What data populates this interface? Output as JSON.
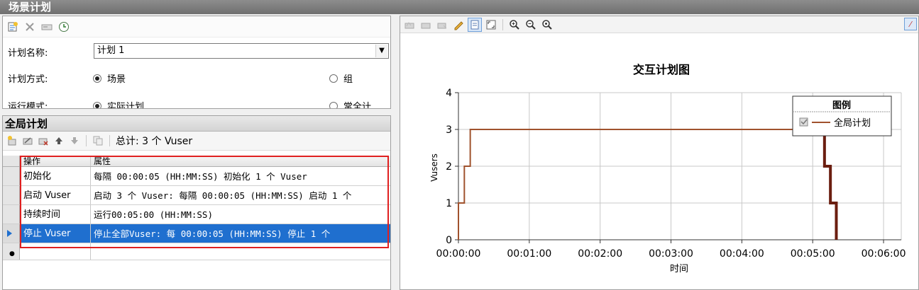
{
  "window": {
    "title": "场景计划"
  },
  "left_toolbar": {
    "icons": [
      "new-schedule-icon",
      "delete-icon",
      "rename-icon",
      "clock-icon"
    ]
  },
  "schedule": {
    "name_label": "计划名称:",
    "name_value": "计划 1",
    "mode_label": "计划方式:",
    "mode_option_scenario": "场景",
    "mode_option_group": "组",
    "run_label": "运行模式:",
    "run_option_real": "实际计划",
    "run_option_basic": "常全计"
  },
  "global": {
    "title": "全局计划",
    "total": "总计: 3 个 Vuser",
    "columns": [
      "操作",
      "属性"
    ],
    "rows": [
      {
        "action": "初始化",
        "property": "每隔 00:00:05 (HH:MM:SS) 初始化 1 个 Vuser"
      },
      {
        "action": "启动 Vuser",
        "property": "启动 3 个 Vuser: 每隔 00:00:05 (HH:MM:SS) 启动 1 个"
      },
      {
        "action": "持续时间",
        "property": "运行00:05:00 (HH:MM:SS)"
      },
      {
        "action": "停止 Vuser",
        "property": "停止全部Vuser: 每 00:00:05 (HH:MM:SS) 停止 1 个"
      }
    ]
  },
  "chart_data": {
    "type": "line",
    "title": "交互计划图",
    "xlabel": "时间",
    "ylabel": "Vusers",
    "xlim": [
      0,
      375
    ],
    "ylim": [
      0,
      4
    ],
    "x_ticks": [
      "00:00:00",
      "00:01:00",
      "00:02:00",
      "00:03:00",
      "00:04:00",
      "00:05:00",
      "00:06:00"
    ],
    "y_ticks": [
      "0",
      "1",
      "2",
      "3",
      "4"
    ],
    "grid": true,
    "legend_position": "top-right",
    "legend_title": "图例",
    "series": [
      {
        "name": "全局计划",
        "color": "#a0522d",
        "points": [
          [
            0,
            0
          ],
          [
            0,
            1
          ],
          [
            5,
            1
          ],
          [
            5,
            2
          ],
          [
            10,
            2
          ],
          [
            10,
            3
          ],
          [
            310,
            3
          ]
        ]
      },
      {
        "color": "#6b1e10",
        "points": [
          [
            310,
            3
          ],
          [
            310,
            2
          ],
          [
            315,
            2
          ],
          [
            315,
            1
          ],
          [
            320,
            1
          ],
          [
            320,
            0
          ]
        ]
      }
    ]
  }
}
